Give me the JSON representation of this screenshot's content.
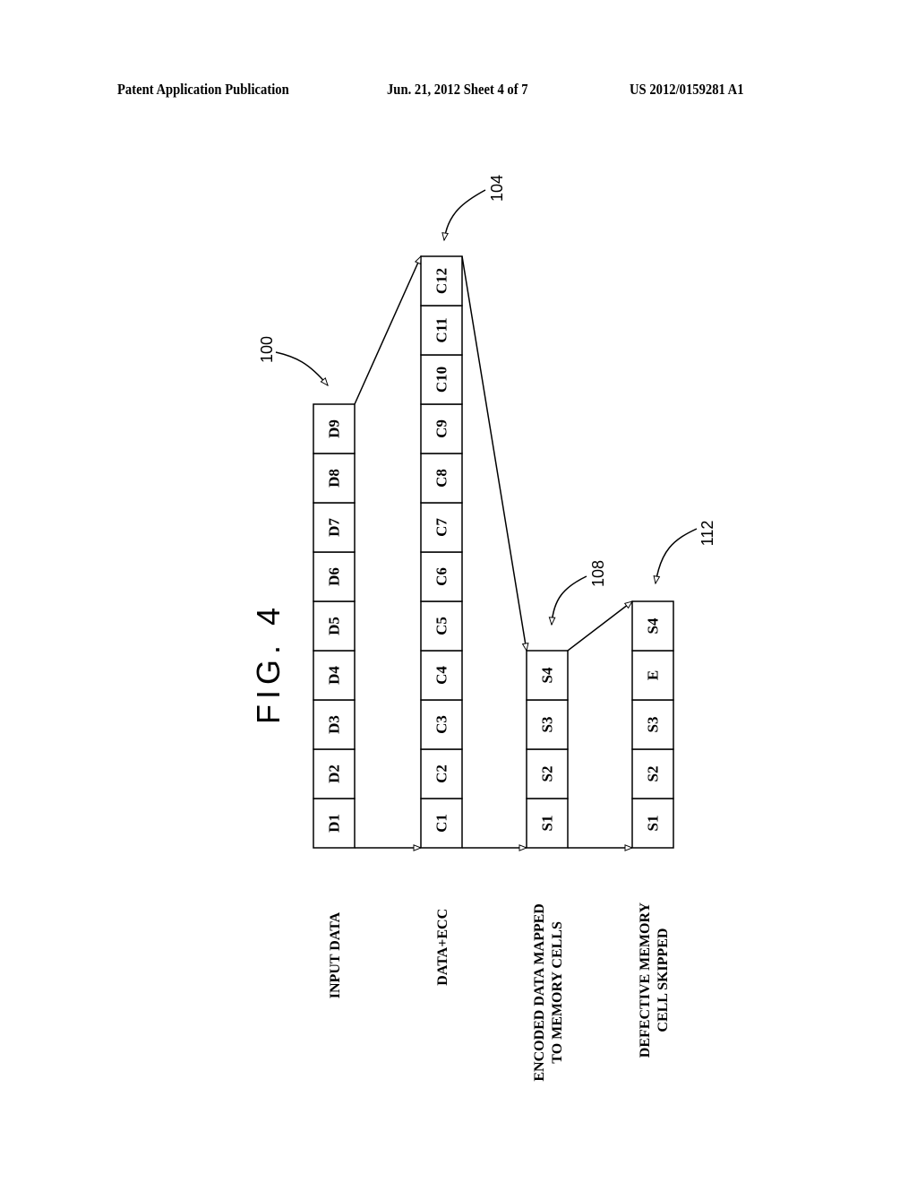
{
  "header": {
    "publication": "Patent Application Publication",
    "date_sheet": "Jun. 21, 2012  Sheet 4 of 7",
    "number": "US 2012/0159281 A1"
  },
  "figure": {
    "title": "FIG. 4",
    "columns": [
      {
        "ref": "100",
        "label": [
          "INPUT DATA"
        ],
        "cells": [
          "D1",
          "D2",
          "D3",
          "D4",
          "D5",
          "D6",
          "D7",
          "D8",
          "D9"
        ]
      },
      {
        "ref": "104",
        "label": [
          "DATA+ECC"
        ],
        "cells": [
          "C1",
          "C2",
          "C3",
          "C4",
          "C5",
          "C6",
          "C7",
          "C8",
          "C9",
          "C10",
          "C11",
          "C12"
        ]
      },
      {
        "ref": "108",
        "label": [
          "ENCODED DATA MAPPED",
          "TO MEMORY CELLS"
        ],
        "cells": [
          "S1",
          "S2",
          "S3",
          "S4"
        ]
      },
      {
        "ref": "112",
        "label": [
          "DEFECTIVE MEMORY",
          "CELL SKIPPED"
        ],
        "cells": [
          "S1",
          "S2",
          "S3",
          "E",
          "S4"
        ]
      }
    ]
  }
}
